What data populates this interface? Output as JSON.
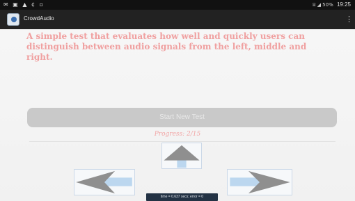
{
  "statusbar": {
    "left_icons": "✉ ▣ ▲ ¢ ▫",
    "signal_icons": "⌸ ◢ 50%",
    "time": "19:25"
  },
  "appbar": {
    "title": "CrowdAudio",
    "menu_icon": "⋮"
  },
  "main": {
    "description": "A simple test that evaluates how well and quickly users can distinguish between audio signals from the left, middle and right.",
    "start_button_label": "Start New Test",
    "progress_text": "Progress: 2/15",
    "timing_text": "time = 0.637 secs; error = 0"
  },
  "icons": {
    "up": "arrow-up-icon",
    "left": "arrow-left-icon",
    "right": "arrow-right-icon"
  },
  "colors": {
    "accent_text": "#f0a0a0",
    "arrow_gray": "#8f8f8f",
    "arrow_blue": "#bcd7ef",
    "button_gray": "#c9c9c9"
  }
}
